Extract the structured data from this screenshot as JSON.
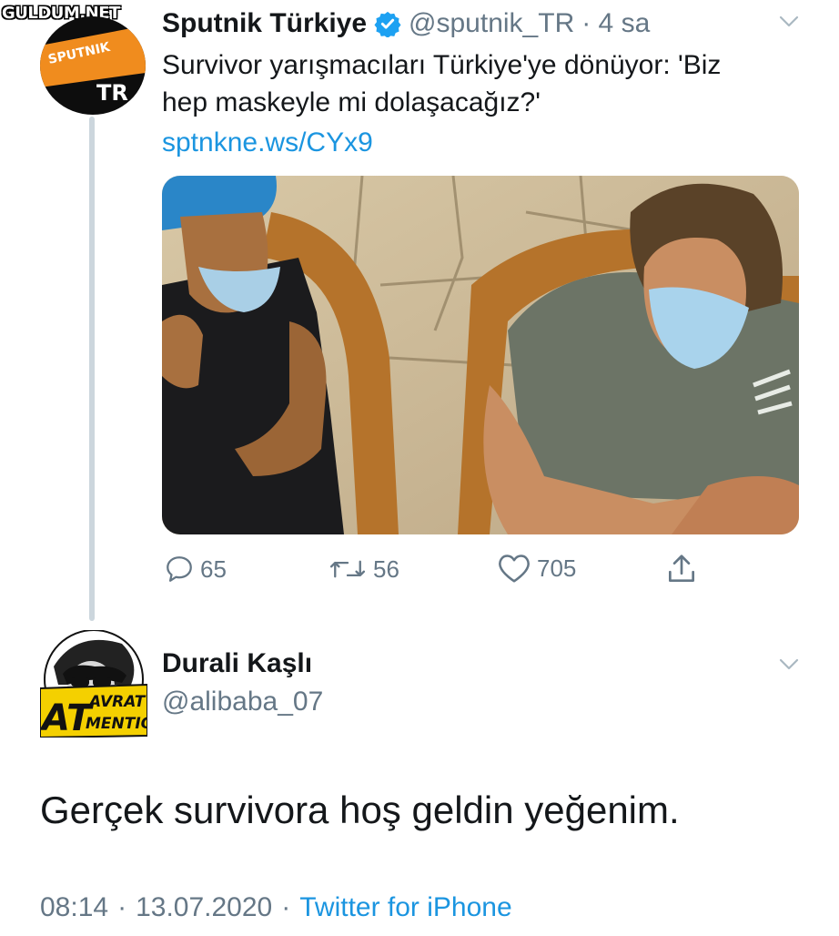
{
  "watermark": "GULDUM.NET",
  "tweet": {
    "author_name": "Sputnik Türkiye",
    "author_handle": "@sputnik_TR",
    "time_ago": "· 4 sa",
    "avatar_text_top": "SPUTNIK",
    "avatar_text_bottom": "TR",
    "text_line1": "Survivor yarışmacıları Türkiye'ye dönüyor: 'Biz",
    "text_line2": "hep maskeyle mi dolaşacağız?'",
    "link": "sptnkne.ws/CYx9",
    "replies": "65",
    "retweets": "56",
    "likes": "705"
  },
  "reply": {
    "author_name": "Durali Kaşlı",
    "author_handle": "@alibaba_07",
    "avatar_badge_line1": "AT",
    "avatar_badge_line2": "AVRAT",
    "avatar_badge_line3": "MENTION",
    "text": "Gerçek survivora hoş geldin yeğenim.",
    "time": "08:14",
    "date": "13.07.2020",
    "source": "Twitter for iPhone"
  },
  "icons": {
    "verified": "verified-badge-icon",
    "chevron": "chevron-down-icon",
    "reply": "reply-icon",
    "retweet": "retweet-icon",
    "like": "heart-icon",
    "share": "share-icon"
  },
  "colors": {
    "link": "#1b95e0",
    "verified": "#1da1f2",
    "secondary_text": "#657786",
    "sputnik_orange": "#f08c1e"
  }
}
